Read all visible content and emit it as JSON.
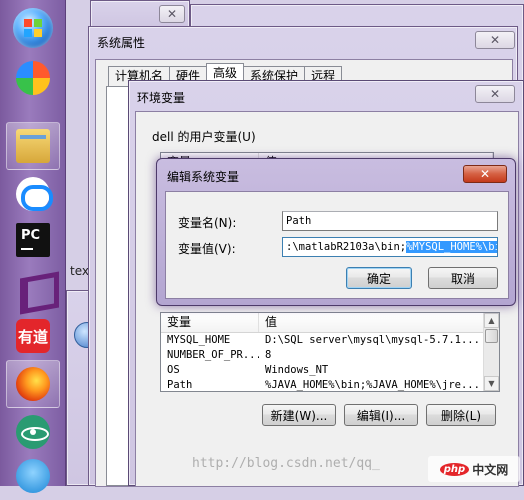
{
  "taskbar": {
    "youdao_label": "有道",
    "pycharm_label": "PC"
  },
  "desktop": {
    "text_label": "text"
  },
  "system_properties": {
    "title": "系统属性",
    "tabs": [
      {
        "label": "计算机名"
      },
      {
        "label": "硬件"
      },
      {
        "label": "高级"
      },
      {
        "label": "系统保护"
      },
      {
        "label": "远程"
      }
    ],
    "active_tab": "高级"
  },
  "env_vars": {
    "title": "环境变量",
    "user_vars_label": "dell 的用户变量(U)",
    "user_columns": [
      "变量",
      "值"
    ],
    "system_columns": [
      "变量",
      "值"
    ],
    "system_rows": [
      {
        "name": "MYSQL_HOME",
        "value": "D:\\SQL server\\mysql\\mysql-5.7.1..."
      },
      {
        "name": "NUMBER_OF_PR...",
        "value": "8"
      },
      {
        "name": "OS",
        "value": "Windows_NT"
      },
      {
        "name": "Path",
        "value": "%JAVA_HOME%\\bin;%JAVA_HOME%\\jre..."
      }
    ],
    "new_label": "新建(W)...",
    "edit_label": "编辑(I)...",
    "delete_label": "删除(L)"
  },
  "edit_dialog": {
    "title": "编辑系统变量",
    "name_label": "变量名(N):",
    "name_value": "Path",
    "value_label": "变量值(V):",
    "value_plain": ":\\matlabR2103a\\bin;",
    "value_selected": "%MYSQL_HOME%\\bin",
    "ok_label": "确定",
    "cancel_label": "取消",
    "close_glyph": "✕"
  },
  "watermark": {
    "text": "http://blog.csdn.net/qq_",
    "logo": "中文网",
    "logo_badge": "php"
  },
  "colors": {
    "selection": "#3399ff",
    "close_red": "#c43a1c",
    "taskbar": "#8b6bb0"
  }
}
